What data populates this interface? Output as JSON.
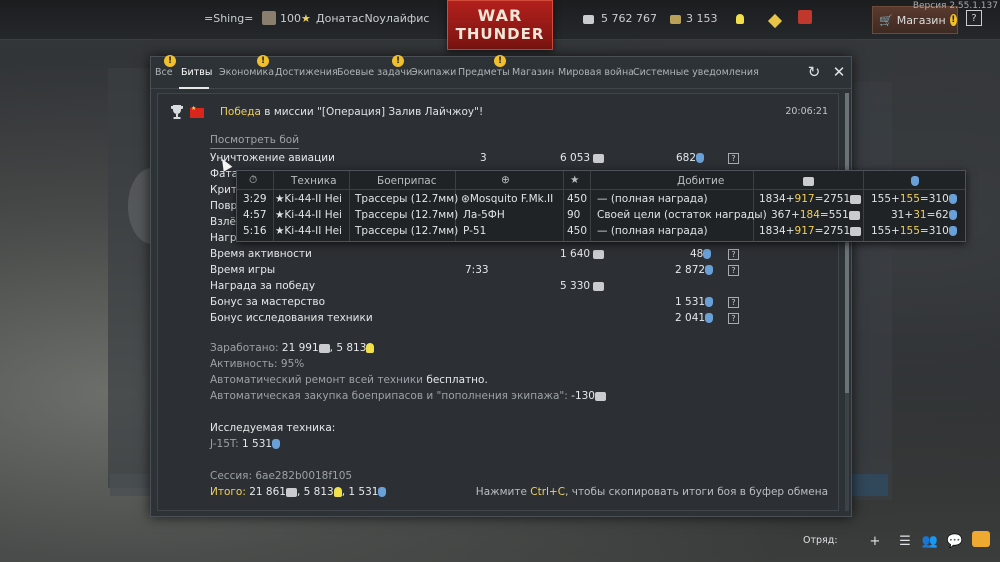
{
  "topbar": {
    "squad_tag": "=Shing=",
    "level": "100",
    "player_name": "ДонатасNoулайфис",
    "silver_lions": "5 762 767",
    "research_points": "3 153",
    "shop_label": "Магазин",
    "help_label": "?",
    "version": "Версия 2.55.1.137"
  },
  "logo": {
    "line1": "WAR",
    "line2": "THUNDER"
  },
  "tabs": [
    {
      "label": "Все"
    },
    {
      "label": "Битвы"
    },
    {
      "label": "Экономика"
    },
    {
      "label": "Достижения"
    },
    {
      "label": "Боевые задачи"
    },
    {
      "label": "Экипажи"
    },
    {
      "label": "Предметы"
    },
    {
      "label": "Магазин"
    },
    {
      "label": "Мировая война"
    },
    {
      "label": "Системные уведомления"
    }
  ],
  "message": {
    "victory": "Победа",
    "text": " в миссии \"[Операция] Залив Лайчжоу\"!",
    "time": "20:06:21",
    "view_battle": "Посмотреть бой"
  },
  "rows": [
    {
      "label": "Уничтожение авиации",
      "count": "3",
      "silver": "6 053",
      "rp": "682"
    },
    {
      "label": "Фата",
      "count": "",
      "silver": "",
      "rp": ""
    },
    {
      "label": "Крит",
      "count": "",
      "silver": "",
      "rp": ""
    },
    {
      "label": "Повр",
      "count": "",
      "silver": "",
      "rp": ""
    },
    {
      "label": "Взлё",
      "count": "",
      "silver": "",
      "rp": ""
    },
    {
      "label": "Нагр",
      "count": "",
      "silver": "",
      "rp": ""
    },
    {
      "label": "Время активности",
      "count": "",
      "silver": "1 640",
      "rp": "48"
    },
    {
      "label": "Время игры",
      "count": "7:33",
      "silver": "",
      "rp": "2 872"
    },
    {
      "label": "Награда за победу",
      "count": "",
      "silver": "5 330",
      "rp": ""
    },
    {
      "label": "Бонус за мастерство",
      "count": "",
      "silver": "",
      "rp": "1 531"
    },
    {
      "label": "Бонус исследования техники",
      "count": "",
      "silver": "",
      "rp": "2 041"
    }
  ],
  "summary": {
    "earned_label": "Заработано:",
    "earned_silver": "21 991",
    "earned_rp": "5 813",
    "activity": "Активность: 95%",
    "repair_prefix": "Автоматический ремонт всей техники",
    "repair_value": "бесплатно.",
    "resupply_prefix": "Автоматическая закупка боеприпасов и \"пополнения экипажа\":",
    "resupply_value": "-130",
    "research_label": "Исследуемая техника:",
    "research_vehicle": "J-15T:",
    "research_rp": "1 531",
    "session": "Сессия: 6ae282b0018f105",
    "total_label": "Итого:",
    "total_silver": "21 861",
    "total_rp": "5 813",
    "total_research": "1 531",
    "copy_hint_pre": "Нажмите ",
    "copy_hint_key": "Ctrl+C",
    "copy_hint_post": ", чтобы скопировать итоги боя в буфер обмена"
  },
  "popup": {
    "headers": {
      "vehicle": "Техника",
      "ammo": "Боеприпас",
      "reward": "Добитие"
    },
    "rows": [
      {
        "time": "3:29",
        "vehicle": "Ki-44-II Hei",
        "ammo": "Трассеры (12.7мм)",
        "target": "Mosquito F.Mk.II",
        "score": "450",
        "reward": "— (полная награда)",
        "sl_a": "1834",
        "sl_b": "917",
        "sl_c": "2751",
        "rp_a": "155",
        "rp_b": "155",
        "rp_c": "310"
      },
      {
        "time": "4:57",
        "vehicle": "Ki-44-II Hei",
        "ammo": "Трассеры (12.7мм)",
        "target": "Ла-5ФН",
        "score": "90",
        "reward": "Своей цели (остаток награды)",
        "sl_a": "367",
        "sl_b": "184",
        "sl_c": "551",
        "rp_a": "31",
        "rp_b": "31",
        "rp_c": "62"
      },
      {
        "time": "5:16",
        "vehicle": "Ki-44-II Hei",
        "ammo": "Трассеры (12.7мм)",
        "target": "P-51",
        "score": "450",
        "reward": "— (полная награда)",
        "sl_a": "1834",
        "sl_b": "917",
        "sl_c": "2751",
        "rp_a": "155",
        "rp_b": "155",
        "rp_c": "310"
      }
    ]
  },
  "bottombar": {
    "squad_label": "Отряд:"
  },
  "colors": {
    "gold": "#f0cf5a",
    "accent_red": "#b2201c",
    "warning": "#f2c12a"
  }
}
